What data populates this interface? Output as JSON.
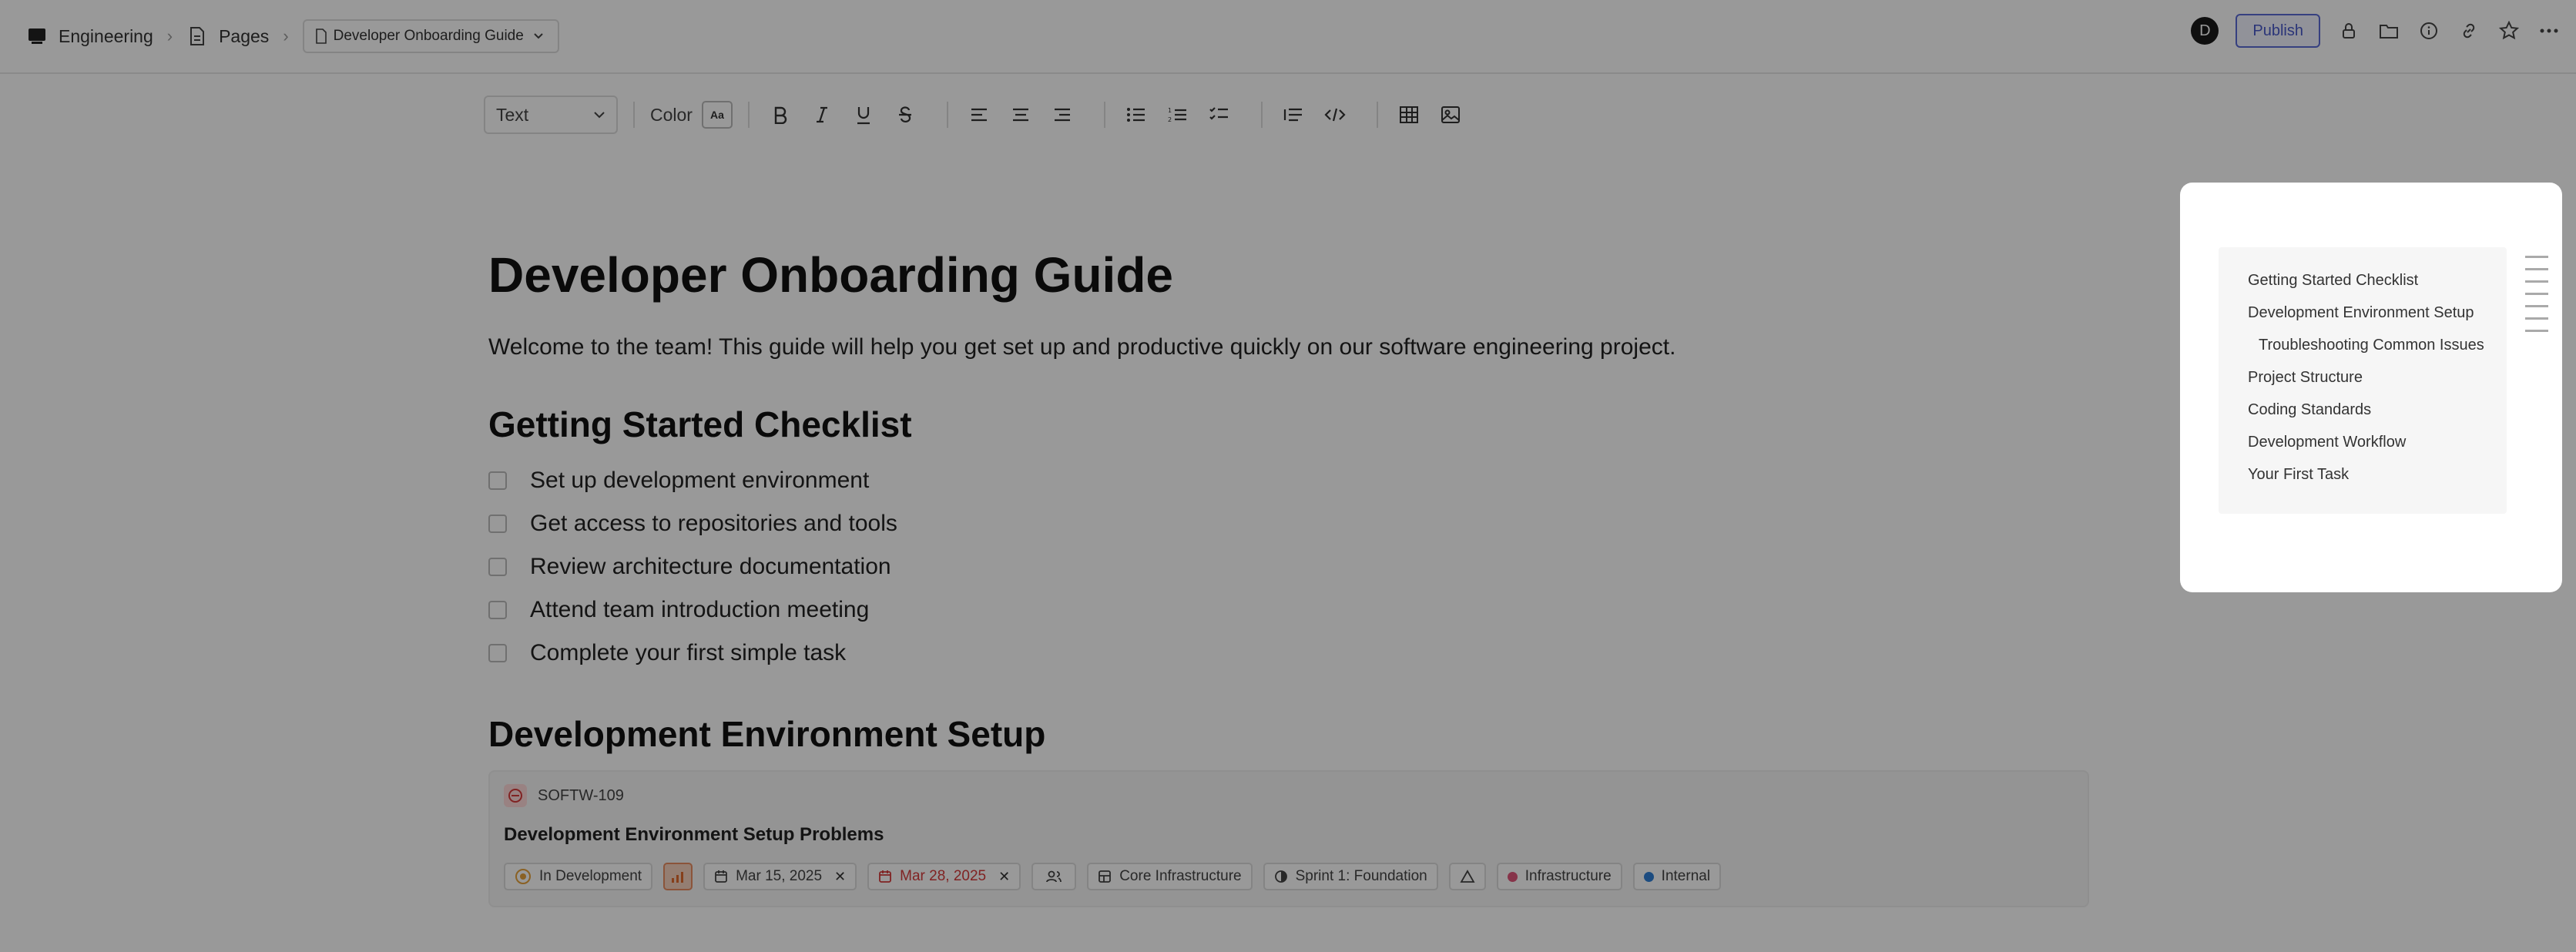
{
  "breadcrumb": {
    "workspace": "Engineering",
    "section": "Pages",
    "document": "Developer Onboarding Guide"
  },
  "topbar": {
    "avatar_initial": "D",
    "publish_label": "Publish"
  },
  "toolbar": {
    "block_type": "Text",
    "color_label": "Color",
    "color_swatch": "Aa"
  },
  "document": {
    "title": "Developer Onboarding Guide",
    "intro": "Welcome to the team! This guide will help you get set up and productive quickly on our software engineering project.",
    "section1_heading": "Getting Started Checklist",
    "checklist": [
      "Set up development environment",
      "Get access to repositories and tools",
      "Review architecture documentation",
      "Attend team introduction meeting",
      "Complete your first simple task"
    ],
    "section2_heading": "Development Environment Setup"
  },
  "issue": {
    "key": "SOFTW-109",
    "title": "Development Environment Setup Problems",
    "status": "In Development",
    "start_date": "Mar 15, 2025",
    "due_date": "Mar 28, 2025",
    "component": "Core Infrastructure",
    "sprint": "Sprint 1: Foundation",
    "label1": "Infrastructure",
    "label1_color": "#e0567a",
    "label2": "Internal",
    "label2_color": "#2f7fd6"
  },
  "toc": {
    "items": [
      "Getting Started Checklist",
      "Development Environment Setup",
      "Troubleshooting Common Issues",
      "Project Structure",
      "Coding Standards",
      "Development Workflow",
      "Your First Task"
    ]
  }
}
